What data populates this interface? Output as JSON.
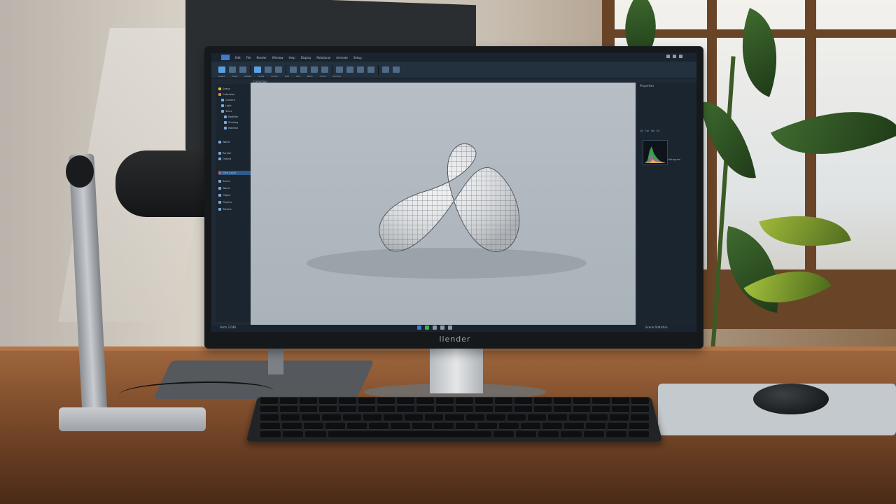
{
  "monitor": {
    "brand": "llender"
  },
  "app": {
    "menus": [
      "Edit",
      "File",
      "Render",
      "Window",
      "Help",
      "Display",
      "Relational",
      "Animate",
      "Setup"
    ],
    "ribbon_labels": [
      "Select",
      "Move",
      "Rotate",
      "Scale",
      "Cursor",
      "Edit",
      "Add",
      "Mesh",
      "Curve",
      "Surface"
    ],
    "path_text": "Collection",
    "outliner": [
      {
        "label": "Scene",
        "color": "#e3c142"
      },
      {
        "label": "Collection",
        "color": "#e38a42"
      },
      {
        "label": "Camera",
        "color": "#7da9d8"
      },
      {
        "label": "Light",
        "color": "#7da9d8"
      },
      {
        "label": "Torus",
        "color": "#7da9d8"
      },
      {
        "label": "Modifier",
        "color": "#7da9d8"
      },
      {
        "label": "Shading",
        "color": "#7da9d8"
      },
      {
        "label": "Material",
        "color": "#7da9d8"
      },
      {
        "label": "World",
        "color": "#7da9d8"
      },
      {
        "label": "Render",
        "color": "#7da9d8"
      },
      {
        "label": "Output",
        "color": "#7da9d8"
      },
      {
        "label": "View Layer",
        "color": "#c45a5a",
        "selected": true
      },
      {
        "label": "Scene",
        "color": "#7da9d8"
      },
      {
        "label": "World",
        "color": "#7da9d8"
      },
      {
        "label": "Object",
        "color": "#7da9d8"
      },
      {
        "label": "Physics",
        "color": "#7da9d8"
      },
      {
        "label": "Texture",
        "color": "#7da9d8"
      }
    ],
    "sidebar_title": "Properties",
    "props_labels": [
      "Lit",
      "Col",
      "Val",
      "Ex"
    ],
    "histogram_caption": "Histogram",
    "status_left": "Verts 2,048",
    "status_right": "Scene Statistics",
    "viewport_object": "twisted torus mesh",
    "accent": "#5aa0e6"
  }
}
